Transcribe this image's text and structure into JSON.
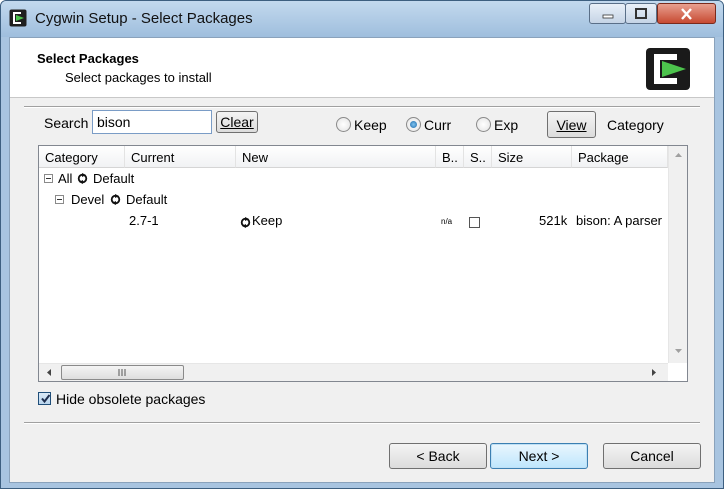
{
  "window": {
    "title": "Cygwin Setup - Select Packages"
  },
  "header": {
    "title": "Select Packages",
    "subtitle": "Select packages to install"
  },
  "search": {
    "label": "Search",
    "value": "bison",
    "clear_label": "Clear"
  },
  "view_options": {
    "radios": [
      {
        "label": "Keep",
        "checked": false
      },
      {
        "label": "Curr",
        "checked": true
      },
      {
        "label": "Exp",
        "checked": false
      }
    ],
    "view_button": "View",
    "current_view": "Category"
  },
  "table": {
    "columns": [
      "Category",
      "Current",
      "New",
      "B..",
      "S..",
      "Size",
      "Package"
    ],
    "tree": [
      {
        "label": "All",
        "state": "Default"
      },
      {
        "label": "Devel",
        "state": "Default"
      }
    ],
    "rows": [
      {
        "current": "2.7-1",
        "new": "Keep",
        "bin": "n/a",
        "size": "521k",
        "package": "bison: A parser"
      }
    ]
  },
  "hide_obsolete": {
    "label": "Hide obsolete packages",
    "checked": true
  },
  "buttons": {
    "back": "< Back",
    "next": "Next >",
    "cancel": "Cancel"
  },
  "colors": {
    "logo_green": "#4cc34c",
    "logo_dark": "#1a1a1a"
  }
}
